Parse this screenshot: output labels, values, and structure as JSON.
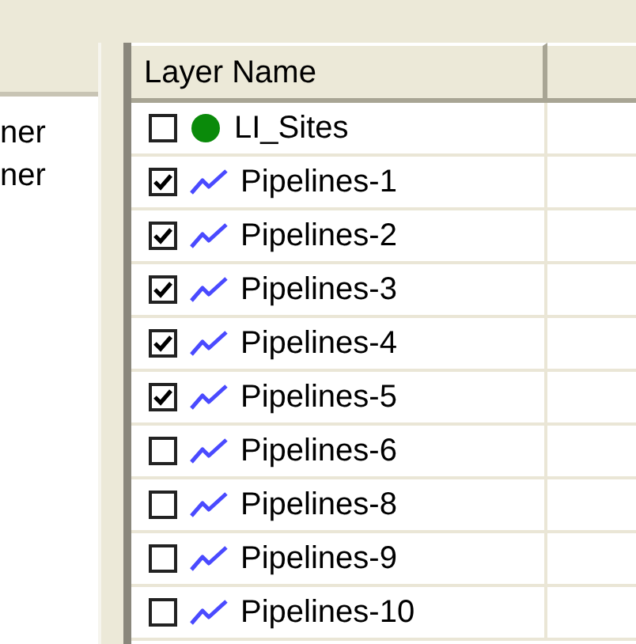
{
  "left_panel": {
    "rows": [
      "ner",
      "ner"
    ]
  },
  "table": {
    "columns": [
      "Layer Name"
    ],
    "rows": [
      {
        "name": "LI_Sites",
        "kind": "point",
        "checked": false
      },
      {
        "name": "Pipelines-1",
        "kind": "line",
        "checked": true
      },
      {
        "name": "Pipelines-2",
        "kind": "line",
        "checked": true
      },
      {
        "name": "Pipelines-3",
        "kind": "line",
        "checked": true
      },
      {
        "name": "Pipelines-4",
        "kind": "line",
        "checked": true
      },
      {
        "name": "Pipelines-5",
        "kind": "line",
        "checked": true
      },
      {
        "name": "Pipelines-6",
        "kind": "line",
        "checked": false
      },
      {
        "name": "Pipelines-8",
        "kind": "line",
        "checked": false
      },
      {
        "name": "Pipelines-9",
        "kind": "line",
        "checked": false
      },
      {
        "name": "Pipelines-10",
        "kind": "line",
        "checked": false
      }
    ]
  }
}
